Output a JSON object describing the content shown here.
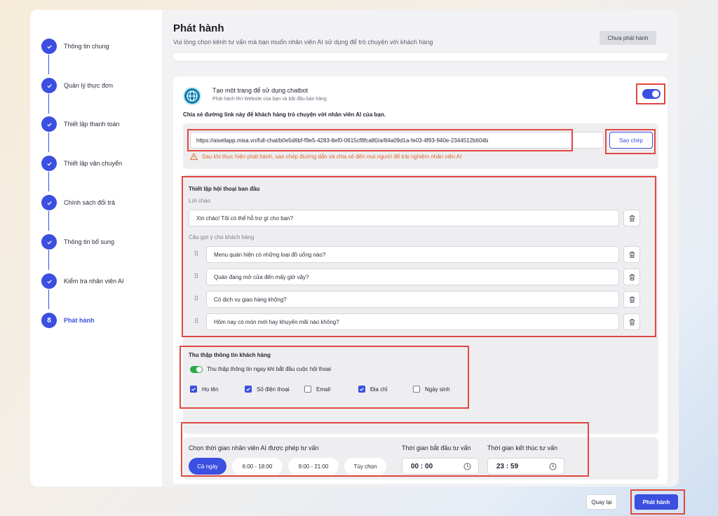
{
  "sidebar": {
    "steps": [
      {
        "label": "Thông tin chung",
        "state": "done"
      },
      {
        "label": "Quản lý thực đơn",
        "state": "done"
      },
      {
        "label": "Thiết lập thanh toán",
        "state": "done"
      },
      {
        "label": "Thiết lập vận chuyển",
        "state": "done"
      },
      {
        "label": "Chính sách đổi trả",
        "state": "done"
      },
      {
        "label": "Thông tin bổ sung",
        "state": "done"
      },
      {
        "label": "Kiểm tra nhân viên AI",
        "state": "done"
      },
      {
        "label": "Phát hành",
        "state": "active",
        "number": "8"
      }
    ]
  },
  "header": {
    "title": "Phát hành",
    "subtitle": "Vui lòng chọn kênh tư vấn mà bạn muốn nhân viên AI sử dụng để trò chuyện với khách hàng",
    "status_badge": "Chưa phát hành"
  },
  "chatbot": {
    "title": "Tạo một trang để sử dụng chatbot",
    "subtitle": "Phát hành lên Website của bạn và bắt đầu bán hàng",
    "enabled": true,
    "share_label": "Chia sẻ đường link này để khách hàng trò chuyện với nhân viên AI của bạn.",
    "link": "https://aisellapp.misa.vn/full-chat/b0e5d6bf-f9e5-4283-8ef0-0615cf8fca80/a/84a09d1a-fe03-4f93-940e-2344512b604b",
    "copy_label": "Sao chép",
    "warning": "Sau khi thực hiện phát hành, sao chép đường dẫn và chia sẻ đến mọi người để trải nghiệm nhân viên AI"
  },
  "conversation": {
    "title": "Thiết lập hội thoại ban đầu",
    "greeting_label": "Lời chào",
    "greeting": "Xin chào! Tôi có thể hỗ trợ gì cho bạn?",
    "suggestions_label": "Câu gợi ý cho khách hàng",
    "suggestions": [
      "Menu quán hiện có những loại đồ uống nào?",
      "Quán đang mở cửa đến mấy giờ vậy?",
      "Có dịch vụ giao hàng không?",
      "Hôm nay có món mới hay khuyến mãi nào không?"
    ]
  },
  "collect": {
    "title": "Thu thập thông tin khách hàng",
    "toggle_label": "Thu thập thông tin ngay khi bắt đầu cuộc hội thoại",
    "toggle_on": true,
    "fields": [
      {
        "label": "Họ tên",
        "checked": true
      },
      {
        "label": "Số điện thoại",
        "checked": true
      },
      {
        "label": "Email",
        "checked": false
      },
      {
        "label": "Địa chỉ",
        "checked": true
      },
      {
        "label": "Ngày sinh",
        "checked": false
      }
    ]
  },
  "schedule": {
    "title": "Chọn thời gian nhân viên AI được phép tư vấn",
    "options": [
      "Cả ngày",
      "6:00 - 18:00",
      "9:00 - 21:00",
      "Tùy chọn"
    ],
    "selected": "Cả ngày",
    "start_label": "Thời gian bắt đầu tư vấn",
    "start_value": "00 : 00",
    "end_label": "Thời gian kết thúc tư vấn",
    "end_value": "23 : 59"
  },
  "footer": {
    "back_label": "Quay lại",
    "publish_label": "Phát hành"
  },
  "colors": {
    "accent": "#3b4fe0",
    "highlight": "#e0483f",
    "warning": "#e06a2c",
    "toggle_on": "#2aa84a"
  }
}
